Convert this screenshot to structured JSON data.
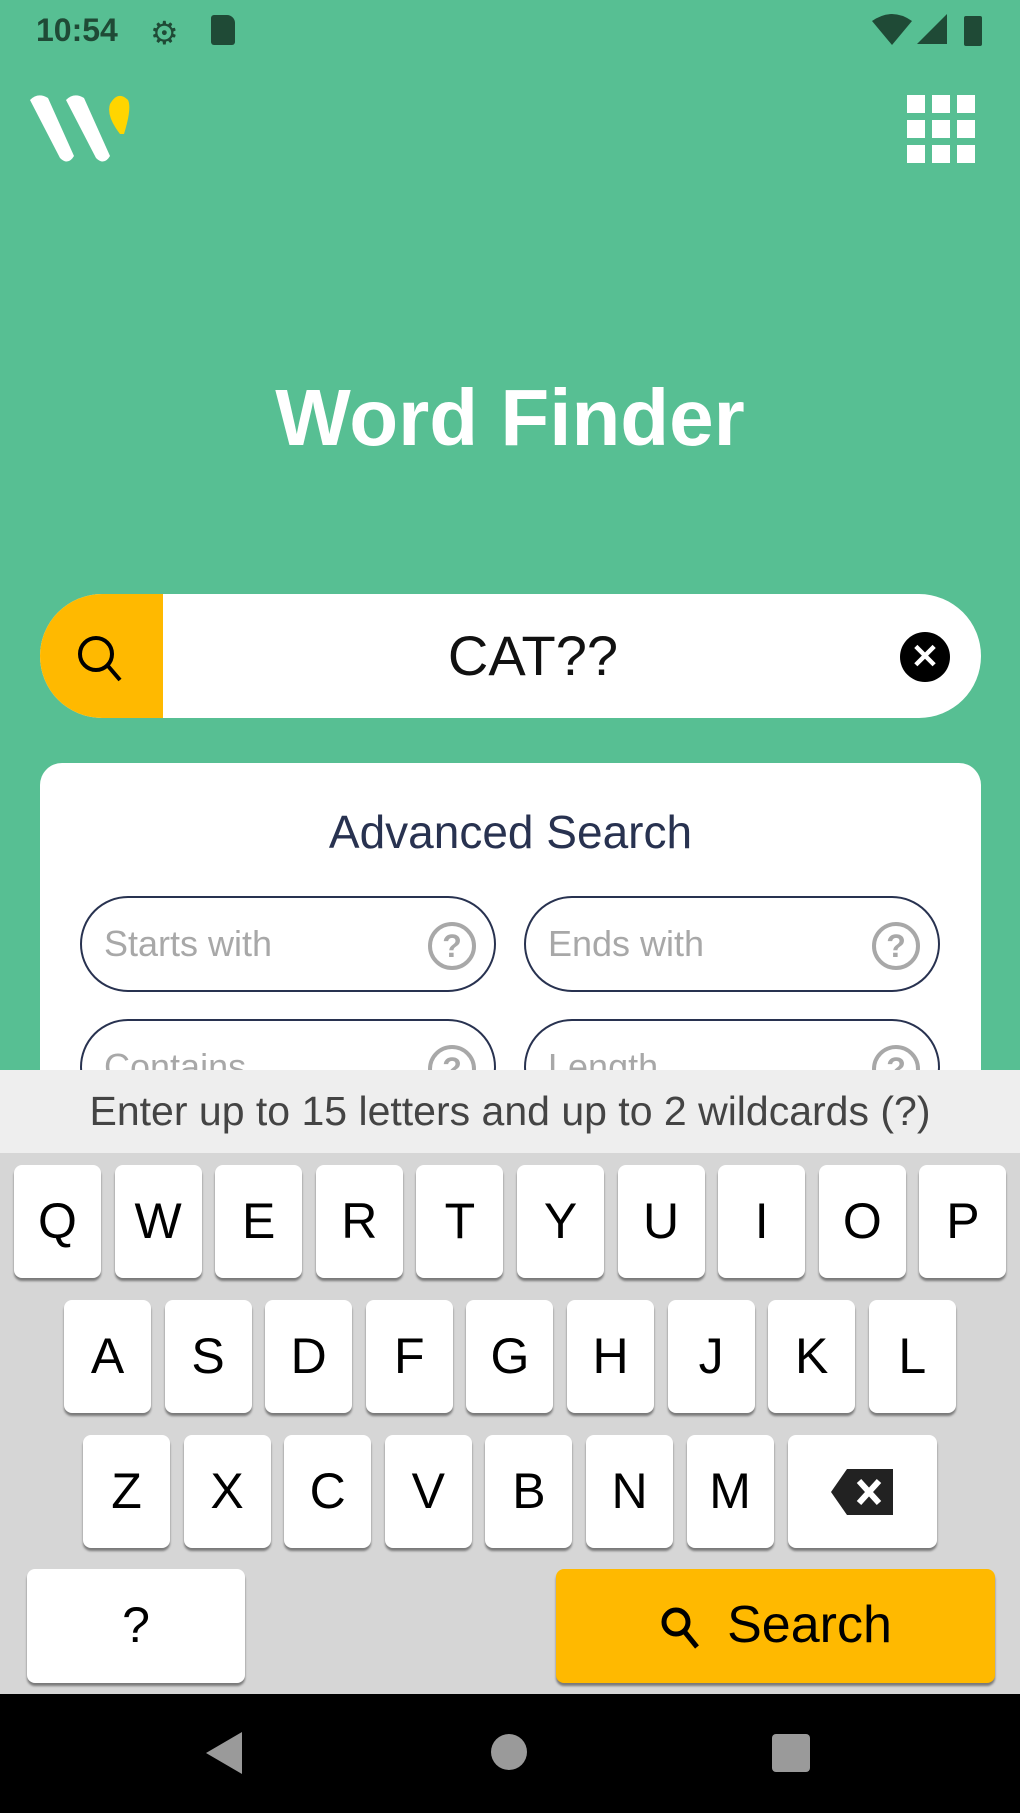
{
  "status_bar": {
    "time": "10:54",
    "icons": [
      "settings-icon",
      "sd-card-icon",
      "wifi-icon",
      "signal-icon",
      "battery-icon"
    ]
  },
  "header": {
    "logo": "W",
    "menu_icon": "apps-grid-icon"
  },
  "title": "Word Finder",
  "search": {
    "value": "CAT??",
    "icon": "search-icon",
    "clear_icon": "close-circle-icon"
  },
  "advanced": {
    "title": "Advanced Search",
    "fields": [
      {
        "placeholder": "Starts with"
      },
      {
        "placeholder": "Ends with"
      },
      {
        "placeholder": "Contains"
      },
      {
        "placeholder": "Length"
      }
    ],
    "help": "?"
  },
  "hint": "Enter up to 15 letters and up to 2 wildcards (?)",
  "keyboard": {
    "rows": [
      [
        "Q",
        "W",
        "E",
        "R",
        "T",
        "Y",
        "U",
        "I",
        "O",
        "P"
      ],
      [
        "A",
        "S",
        "D",
        "F",
        "G",
        "H",
        "J",
        "K",
        "L"
      ],
      [
        "Z",
        "X",
        "C",
        "V",
        "B",
        "N",
        "M"
      ]
    ],
    "wildcard": "?",
    "search_label": "Search"
  },
  "colors": {
    "background": "#57bf93",
    "accent": "#ffb900",
    "text_dark": "#283250"
  }
}
